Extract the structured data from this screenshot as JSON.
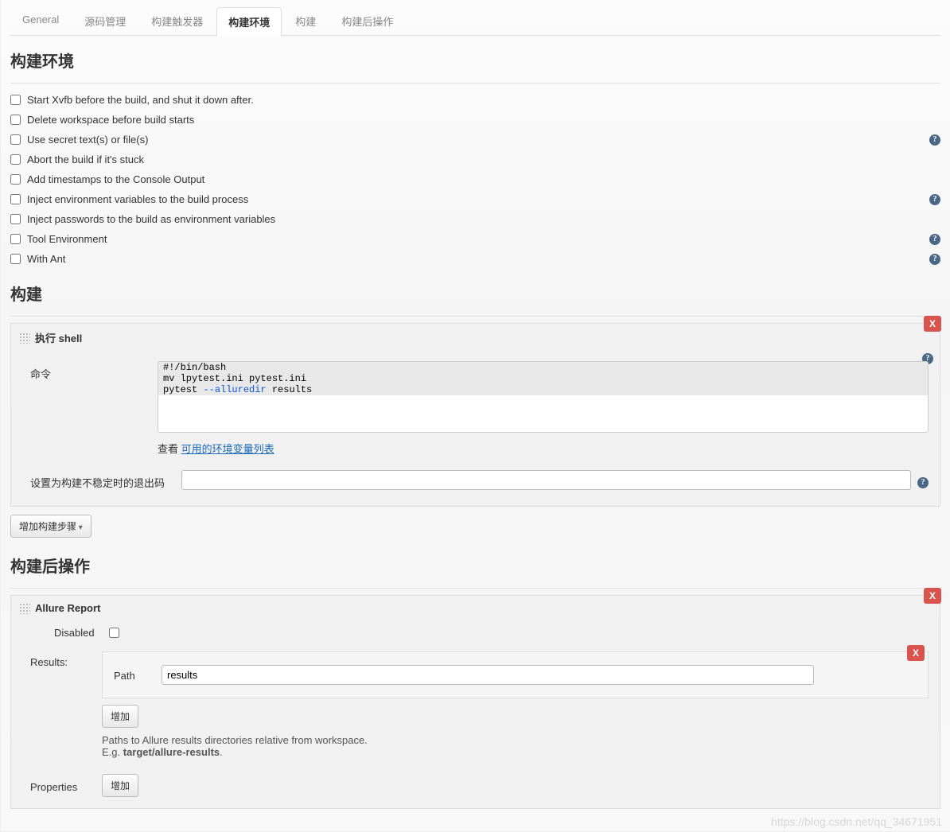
{
  "tabs": {
    "items": [
      {
        "label": "General"
      },
      {
        "label": "源码管理"
      },
      {
        "label": "构建触发器"
      },
      {
        "label": "构建环境"
      },
      {
        "label": "构建"
      },
      {
        "label": "构建后操作"
      }
    ],
    "activeIndex": 3
  },
  "sections": {
    "env_title": "构建环境",
    "build_title": "构建",
    "post_title": "构建后操作"
  },
  "env": {
    "opts": [
      {
        "label": "Start Xvfb before the build, and shut it down after.",
        "help": false
      },
      {
        "label": "Delete workspace before build starts",
        "help": false
      },
      {
        "label": "Use secret text(s) or file(s)",
        "help": true
      },
      {
        "label": "Abort the build if it's stuck",
        "help": false
      },
      {
        "label": "Add timestamps to the Console Output",
        "help": false
      },
      {
        "label": "Inject environment variables to the build process",
        "help": true
      },
      {
        "label": "Inject passwords to the build as environment variables",
        "help": false
      },
      {
        "label": "Tool Environment",
        "help": true
      },
      {
        "label": "With Ant",
        "help": true
      }
    ]
  },
  "build": {
    "shell_title": "执行 shell",
    "cmd_label": "命令",
    "code_line1": "#!/bin/bash",
    "code_line2": "mv lpytest.ini pytest.ini",
    "code_line3_a": "pytest ",
    "code_line3_b": "--alluredir",
    "code_line3_c": " results",
    "hint_prefix": "查看",
    "hint_link": "可用的环境变量列表",
    "exit_label": "设置为构建不稳定时的退出码",
    "exit_value": "",
    "add_step": "增加构建步骤"
  },
  "post": {
    "allure_title": "Allure Report",
    "disabled_label": "Disabled",
    "results_label": "Results:",
    "path_label": "Path",
    "path_value": "results",
    "add": "增加",
    "desc_line1": "Paths to Allure results directories relative from workspace.",
    "desc_eg": "E.g. ",
    "desc_b": "target/allure-results",
    "desc_dot": ".",
    "props_label": "Properties",
    "props_add": "增加"
  },
  "ui": {
    "x": "X",
    "q": "?"
  },
  "watermark": "https://blog.csdn.net/qq_34671951"
}
